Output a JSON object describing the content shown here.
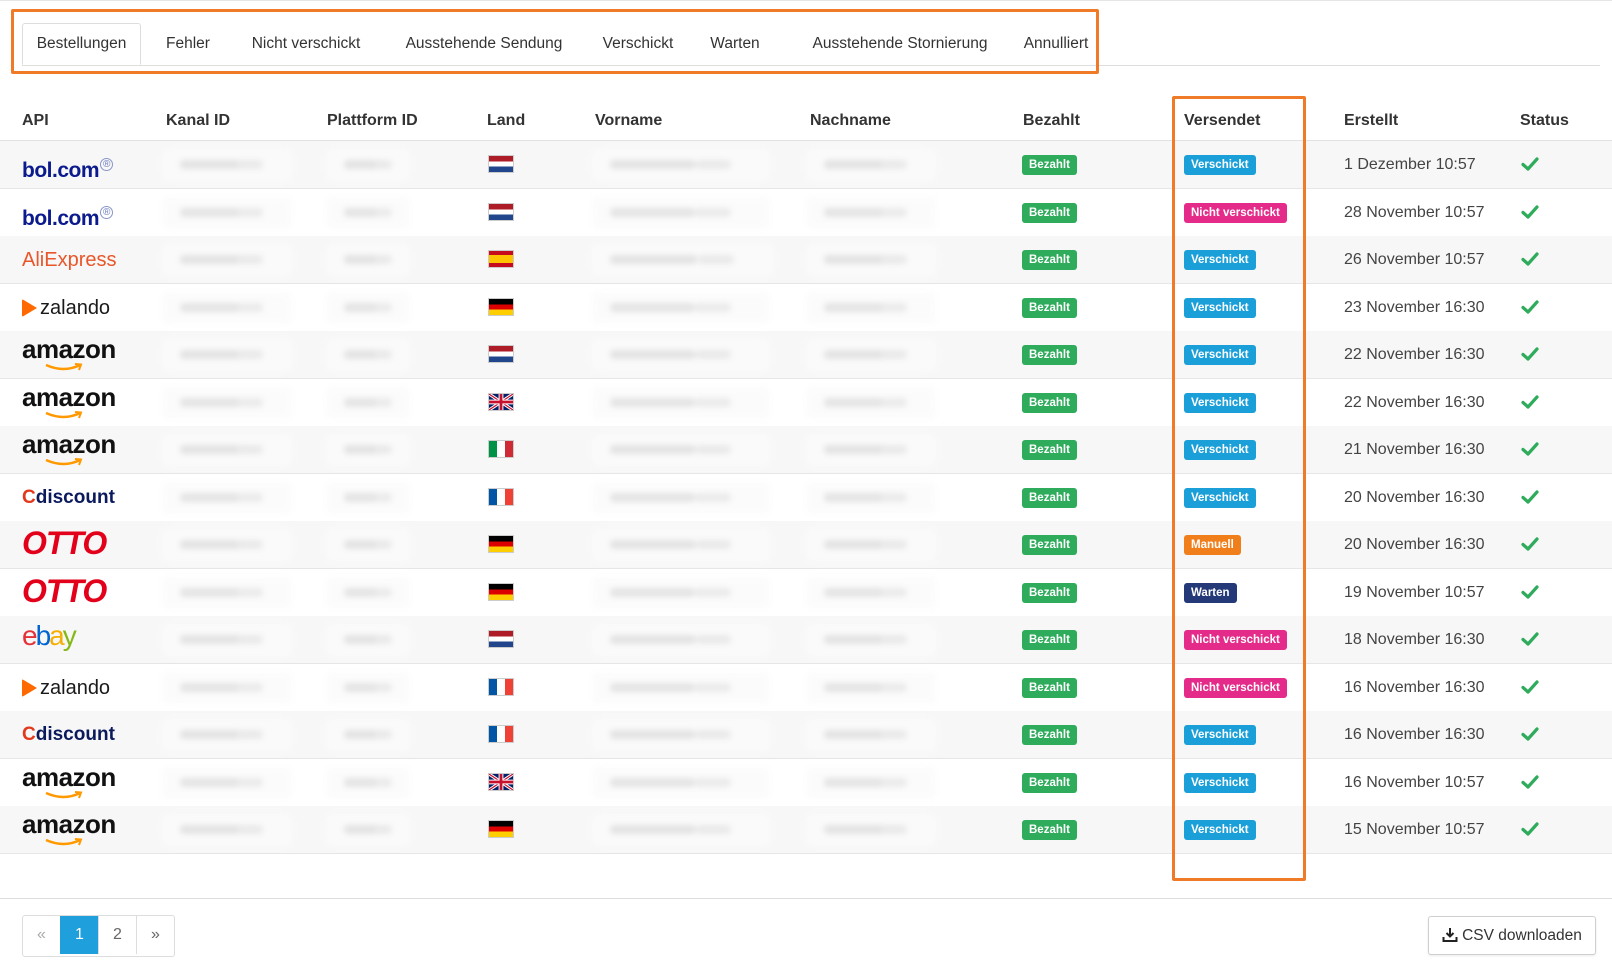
{
  "tabs": [
    "Bestellungen",
    "Fehler",
    "Nicht verschickt",
    "Ausstehende Sendung",
    "Verschickt",
    "Warten",
    "Ausstehende Stornierung",
    "Annulliert"
  ],
  "table": {
    "headers": {
      "api": "API",
      "kanal_id": "Kanal ID",
      "plattform_id": "Plattform ID",
      "land": "Land",
      "vorname": "Vorname",
      "nachname": "Nachname",
      "bezahlt": "Bezahlt",
      "versendet": "Versendet",
      "erstellt": "Erstellt",
      "status": "Status"
    },
    "rows": [
      {
        "api": "bol.com",
        "land": "nl",
        "bezahlt": "Bezahlt",
        "versendet": "Verschickt",
        "erstellt": "1 Dezember 10:57"
      },
      {
        "api": "bol.com",
        "land": "nl",
        "bezahlt": "Bezahlt",
        "versendet": "Nicht verschickt",
        "erstellt": "28 November 10:57"
      },
      {
        "api": "AliExpress",
        "land": "es",
        "bezahlt": "Bezahlt",
        "versendet": "Verschickt",
        "erstellt": "26 November 10:57"
      },
      {
        "api": "zalando",
        "land": "de",
        "bezahlt": "Bezahlt",
        "versendet": "Verschickt",
        "erstellt": "23 November 16:30"
      },
      {
        "api": "amazon",
        "land": "nl",
        "bezahlt": "Bezahlt",
        "versendet": "Verschickt",
        "erstellt": "22 November 16:30"
      },
      {
        "api": "amazon",
        "land": "gb",
        "bezahlt": "Bezahlt",
        "versendet": "Verschickt",
        "erstellt": "22 November 16:30"
      },
      {
        "api": "amazon",
        "land": "it",
        "bezahlt": "Bezahlt",
        "versendet": "Verschickt",
        "erstellt": "21 November 16:30"
      },
      {
        "api": "Cdiscount",
        "land": "fr",
        "bezahlt": "Bezahlt",
        "versendet": "Verschickt",
        "erstellt": "20 November 16:30"
      },
      {
        "api": "OTTO",
        "land": "de",
        "bezahlt": "Bezahlt",
        "versendet": "Manuell",
        "erstellt": "20 November 16:30"
      },
      {
        "api": "OTTO",
        "land": "de",
        "bezahlt": "Bezahlt",
        "versendet": "Warten",
        "erstellt": "19 November 10:57"
      },
      {
        "api": "ebay",
        "land": "nl",
        "bezahlt": "Bezahlt",
        "versendet": "Nicht verschickt",
        "erstellt": "18 November 16:30"
      },
      {
        "api": "zalando",
        "land": "fr",
        "bezahlt": "Bezahlt",
        "versendet": "Nicht verschickt",
        "erstellt": "16 November 16:30"
      },
      {
        "api": "Cdiscount",
        "land": "fr",
        "bezahlt": "Bezahlt",
        "versendet": "Verschickt",
        "erstellt": "16 November 16:30"
      },
      {
        "api": "amazon",
        "land": "gb",
        "bezahlt": "Bezahlt",
        "versendet": "Verschickt",
        "erstellt": "16 November 10:57"
      },
      {
        "api": "amazon",
        "land": "de",
        "bezahlt": "Bezahlt",
        "versendet": "Verschickt",
        "erstellt": "15 November 10:57"
      }
    ]
  },
  "status_colors": {
    "Verschickt": "#1b9fd8",
    "Nicht verschickt": "#e52b8a",
    "Manuell": "#f07f1b",
    "Warten": "#243a78",
    "Bezahlt": "#2eab5b",
    "check": "#2eab5b",
    "highlight": "#ef7a28"
  },
  "pagination": {
    "prev": "«",
    "pages": [
      "1",
      "2"
    ],
    "active": "1",
    "next": "»"
  },
  "csv_button": {
    "label": "CSV downloaden",
    "icon": "download-icon"
  }
}
